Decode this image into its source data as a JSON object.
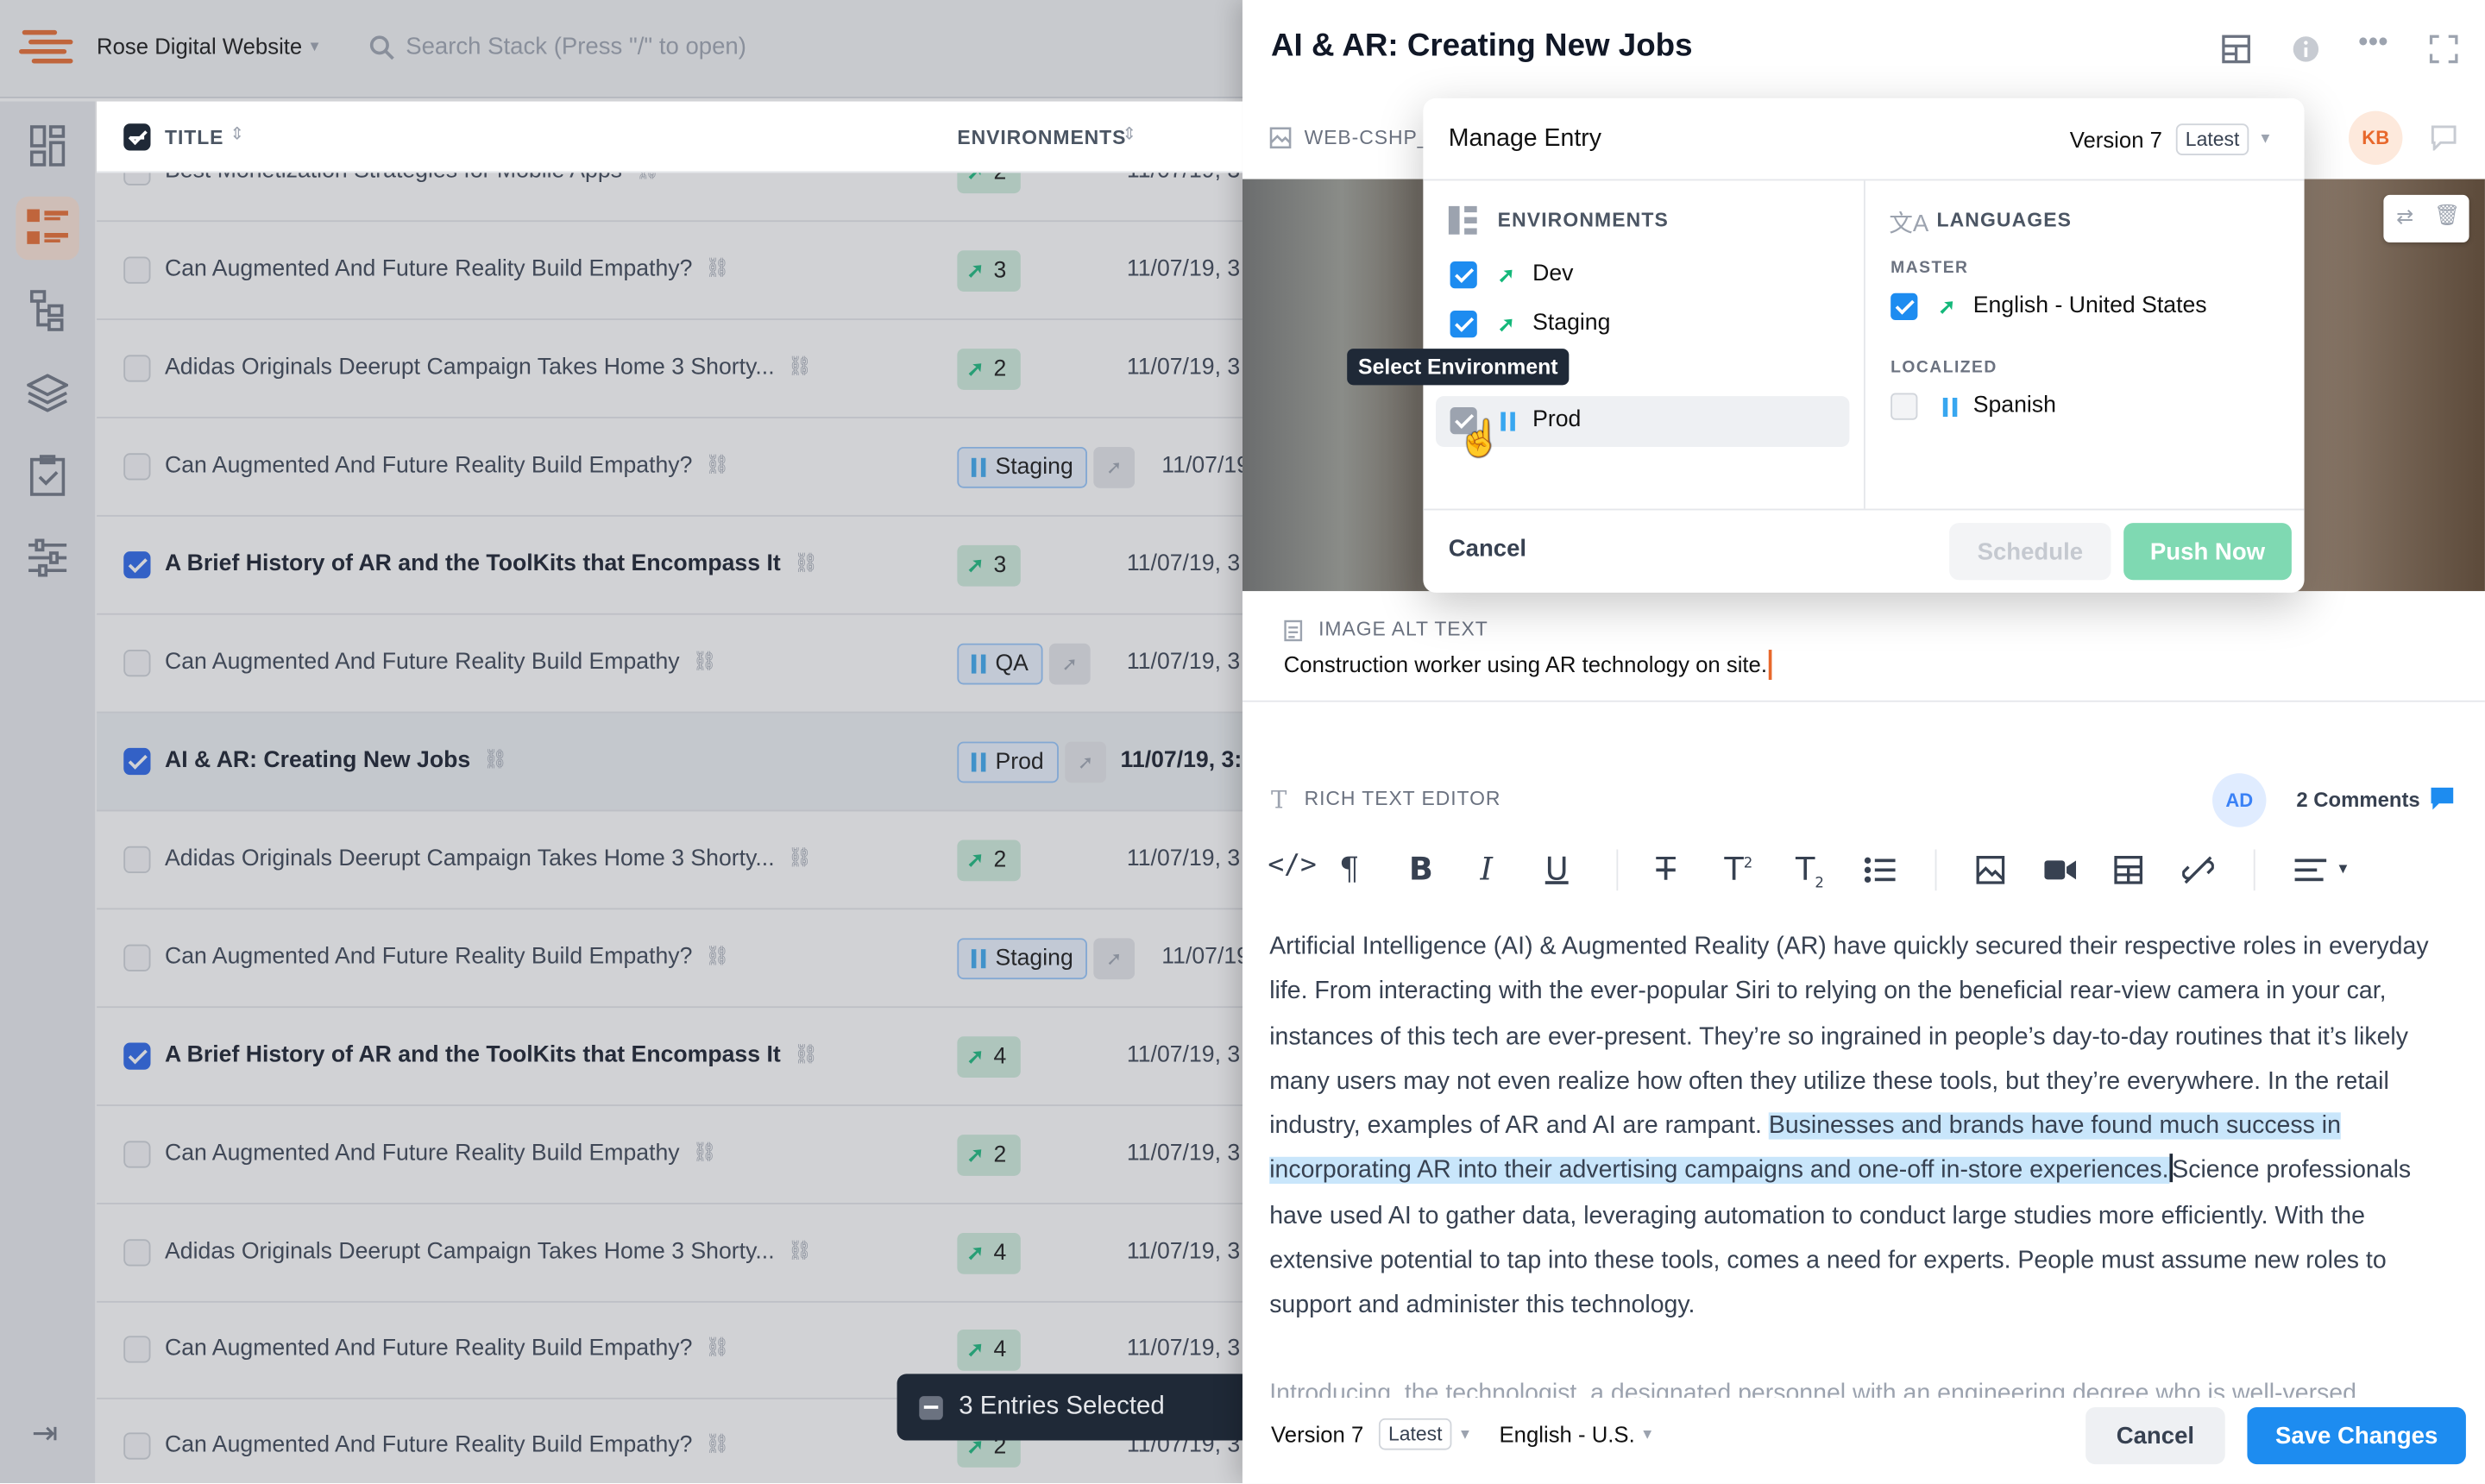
{
  "app": {
    "workspace": "Rose Digital Website",
    "search_placeholder": "Search Stack (Press \"/\" to open)"
  },
  "list": {
    "col_title": "TITLE",
    "col_environments": "ENVIRONMENTS",
    "rows": [
      {
        "title": "Best Monetization Strategies for Mobile Apps",
        "env": "2",
        "date": "11/07/19, 3",
        "checked": false,
        "bold": false
      },
      {
        "title": "Can Augmented And Future Reality Build Empathy?",
        "env": "3",
        "date": "11/07/19, 3",
        "checked": false,
        "bold": false
      },
      {
        "title": "Adidas Originals Deerupt Campaign Takes Home 3 Shorty...",
        "env": "2",
        "date": "11/07/19, 3",
        "checked": false,
        "bold": false
      },
      {
        "title": "Can Augmented And Future Reality Build Empathy?",
        "env": "Staging",
        "date": "11/07/19",
        "checked": false,
        "bold": false
      },
      {
        "title": "A Brief History of AR and the ToolKits that Encompass It",
        "env": "3",
        "date": "11/07/19, 3",
        "checked": true,
        "bold": true
      },
      {
        "title": "Can Augmented And Future Reality Build Empathy",
        "env": "QA",
        "date": "11/07/19, 3",
        "checked": false,
        "bold": false
      },
      {
        "title": "AI & AR: Creating New Jobs",
        "env": "Prod",
        "date": "11/07/19, 3:",
        "checked": true,
        "bold": true
      },
      {
        "title": "Adidas Originals Deerupt Campaign Takes Home 3 Shorty...",
        "env": "2",
        "date": "11/07/19, 3",
        "checked": false,
        "bold": false
      },
      {
        "title": "Can Augmented And Future Reality Build Empathy?",
        "env": "Staging",
        "date": "11/07/19",
        "checked": false,
        "bold": false
      },
      {
        "title": "A Brief History of AR and the ToolKits that Encompass It",
        "env": "4",
        "date": "11/07/19, 3",
        "checked": true,
        "bold": true
      },
      {
        "title": "Can Augmented And Future Reality Build Empathy",
        "env": "2",
        "date": "11/07/19, 3",
        "checked": false,
        "bold": false
      },
      {
        "title": "Adidas Originals Deerupt Campaign Takes Home 3 Shorty...",
        "env": "4",
        "date": "11/07/19, 3",
        "checked": false,
        "bold": false
      },
      {
        "title": "Can Augmented And Future Reality Build Empathy?",
        "env": "4",
        "date": "11/07/19, 3",
        "checked": false,
        "bold": false
      },
      {
        "title": "Can Augmented And Future Reality Build Empathy?",
        "env": "2",
        "date": "11/07/19, 3",
        "checked": false,
        "bold": false
      }
    ],
    "selection_label": "3 Entries Selected"
  },
  "entry": {
    "title": "AI & AR: Creating New Jobs",
    "asset_id": "WEB-CSHP_",
    "user_initials": "KB",
    "alt_label": "IMAGE ALT TEXT",
    "alt_text": "Construction worker using AR technology on site.",
    "rte_label": "RICH TEXT EDITOR",
    "commenter_initials": "AD",
    "comments": "2 Comments",
    "body_a": "Artificial Intelligence (AI) & Augmented Reality (AR) have quickly secured their respective roles in everyday life. From interacting with the ever-popular Siri to relying on the beneficial rear-view camera in your car, instances of this tech are ever-present. They’re so ingrained in people’s day-to-day routines that it’s likely many users may not even realize how often they utilize these tools, but they’re everywhere. In the retail industry, examples of AR and AI are rampant. ",
    "body_highlight": "Businesses and brands have found much success in incorporating AR into their advertising campaigns and one-off in-store experiences.",
    "body_b": "Science professionals have used AI to gather data, leveraging automation to conduct large studies more efficiently. With the extensive potential to tap into these tools, comes a need for experts. People must assume new roles to support and administer this technology.",
    "body_intro": "Introducing, the technologist, a designated personnel with an engineering degree who is well-versed",
    "footer": {
      "version": "Version 7",
      "latest": "Latest",
      "language": "English - U.S.",
      "cancel": "Cancel",
      "save": "Save Changes"
    }
  },
  "modal": {
    "title": "Manage Entry",
    "version": "Version 7",
    "latest": "Latest",
    "environments_label": "ENVIRONMENTS",
    "environments": [
      {
        "name": "Dev",
        "checked": true
      },
      {
        "name": "Staging",
        "checked": true
      },
      {
        "name": "Prod",
        "checked": true
      }
    ],
    "tooltip": "Select Environment",
    "languages_label": "LANGUAGES",
    "master_label": "MASTER",
    "master_language": "English - United States",
    "localized_label": "LOCALIZED",
    "localized_language": "Spanish",
    "cancel": "Cancel",
    "schedule": "Schedule",
    "push": "Push Now"
  },
  "colors": {
    "accent": "#1d8cf0",
    "brand": "#e8682c",
    "success": "#14b87a"
  }
}
